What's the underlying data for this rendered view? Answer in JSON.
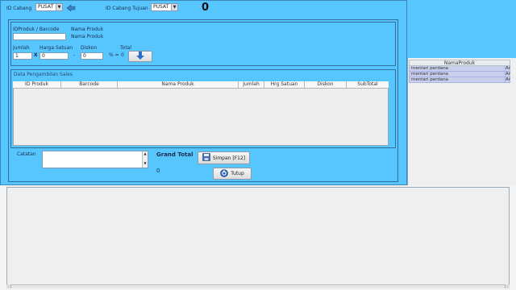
{
  "header": {
    "id_cabang_label": "ID Cabang",
    "id_cabang_value": "PUSAT",
    "id_cabang_tujuan_label": "ID Cabang Tujuan",
    "id_cabang_tujuan_value": "PUSAT",
    "counter": "0"
  },
  "form": {
    "idproduk_barcode_label": "IDProduk / Barcode",
    "nama_produk_label": "Nama Produk",
    "nama_produk_value": "Nama Produk",
    "jumlah_label": "Jumlah",
    "jumlah_value": "1",
    "harga_satuan_label": "Harga Satuan",
    "harga_satuan_value": "0",
    "diskon_label": "Diskon",
    "diskon_value": "0",
    "total_label": "Total",
    "total_value": "0",
    "x_symbol": "X",
    "minus_symbol": "-",
    "percent_eq": "% ="
  },
  "sales": {
    "title": "Data Pengambilan Sales",
    "columns": [
      "ID Produk",
      "Barcode",
      "Nama Produk",
      "Jumlah",
      "Hrg Satuan",
      "Diskon",
      "SubTotal"
    ]
  },
  "footer": {
    "catatan_label": "Catatan",
    "grand_total_label": "Grand Total",
    "grand_total_value": "0",
    "simpan_label": "Simpan [F12]",
    "tutup_label": "Tutup"
  },
  "right_table": {
    "header": "NamaProduk",
    "rows": [
      {
        "name": "mentari perdana",
        "extra": "Ar"
      },
      {
        "name": "mentari perdana",
        "extra": "Ar"
      },
      {
        "name": "mentari perdana",
        "extra": "Ar"
      }
    ]
  },
  "icons": [
    "dropdown-arrow-icon",
    "refresh-icon",
    "down-arrow-icon",
    "save-icon",
    "close-icon"
  ],
  "colors": {
    "panel_blue": "#57c6ff",
    "border_blue": "#2f6e9a"
  }
}
